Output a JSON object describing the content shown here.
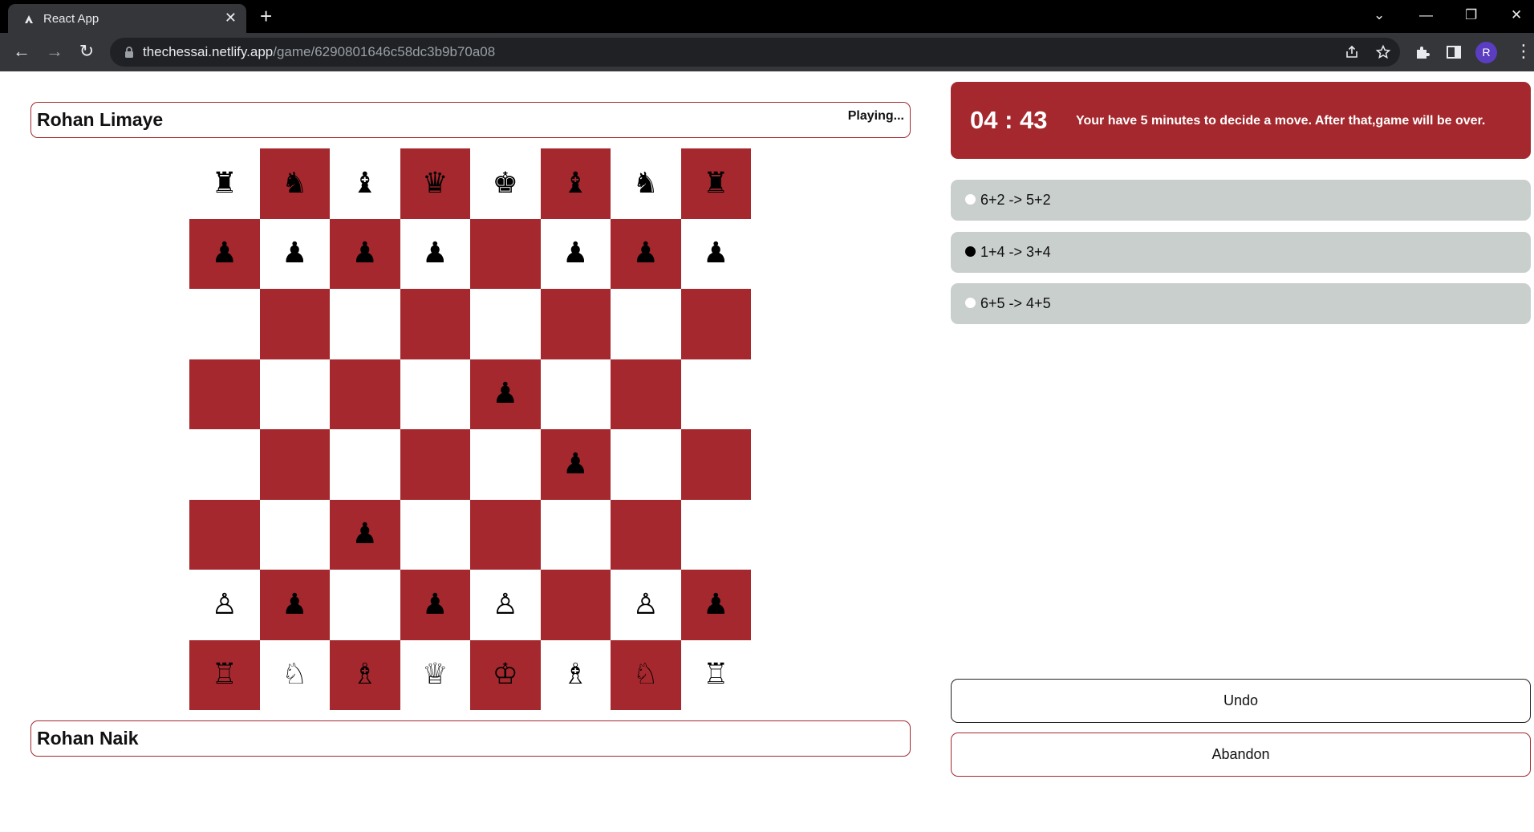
{
  "browser": {
    "tab_title": "React App",
    "tab_close": "✕",
    "new_tab": "+",
    "url_host": "thechessai.netlify.app",
    "url_path": "/game/6290801646c58dc3b9b70a08",
    "profile_initial": "R",
    "controls": {
      "tab_search": "⌄",
      "minimize": "—",
      "restore": "❐",
      "close": "✕"
    },
    "nav": {
      "back": "←",
      "forward": "→",
      "reload": "↻",
      "menu": "⋮"
    }
  },
  "game": {
    "opponent": {
      "name": "Rohan Limaye",
      "status": "Playing..."
    },
    "player": {
      "name": "Rohan Naik"
    },
    "timer": "04 : 43",
    "timer_message": "Your have 5 minutes to decide a move. After that,game will be over.",
    "moves": [
      {
        "text": "6+2 -> 5+2",
        "side": "white"
      },
      {
        "text": "1+4 -> 3+4",
        "side": "black"
      },
      {
        "text": "6+5 -> 4+5",
        "side": "white"
      }
    ],
    "buttons": {
      "undo": "Undo",
      "abandon": "Abandon"
    },
    "colors": {
      "accent": "#a4282d",
      "move_bg": "#c9cfcd"
    },
    "board": [
      [
        "♜",
        "♞",
        "♝",
        "♛",
        "♚",
        "♝",
        "♞",
        "♜"
      ],
      [
        "♟",
        "♟",
        "♟",
        "♟",
        "",
        "♟",
        "♟",
        "♟"
      ],
      [
        "",
        "",
        "",
        "",
        "",
        "",
        "",
        ""
      ],
      [
        "",
        "",
        "",
        "",
        "♟",
        "",
        "",
        ""
      ],
      [
        "",
        "",
        "",
        "",
        "",
        "♟",
        "",
        ""
      ],
      [
        "",
        "",
        "♟",
        "",
        "",
        "",
        "",
        ""
      ],
      [
        "♙",
        "♟",
        "",
        "♟",
        "♙",
        "",
        "♙",
        "♟"
      ],
      [
        "♖",
        "♘",
        "♗",
        "♕",
        "♔",
        "♗",
        "♘",
        "♖"
      ]
    ]
  }
}
